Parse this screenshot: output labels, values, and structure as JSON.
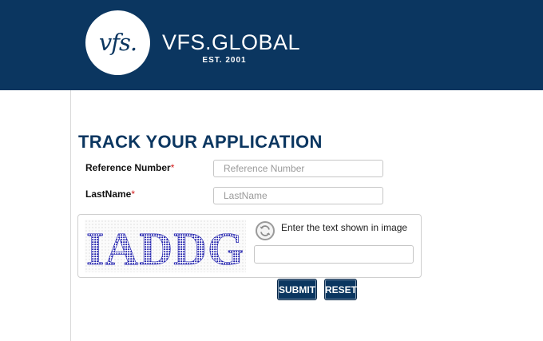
{
  "header": {
    "logo_mark": "vfs.",
    "brand": "VFS.GLOBAL",
    "established": "EST. 2001",
    "background": "#0b3660"
  },
  "form": {
    "title": "TRACK YOUR APPLICATION",
    "reference": {
      "label": "Reference Number",
      "required_mark": "*",
      "placeholder": "Reference Number",
      "value": ""
    },
    "lastname": {
      "label": "LastName",
      "required_mark": "*",
      "placeholder": "LastName",
      "value": ""
    },
    "captcha": {
      "image_text": "IADDG",
      "prompt": "Enter the text shown in image",
      "value": "",
      "refresh_icon": "refresh-icon"
    },
    "buttons": {
      "submit": "SUBMIT",
      "reset": "RESET"
    }
  },
  "colors": {
    "accent": "#0b3660",
    "required": "#d11a1a",
    "captcha_text": "#1a1aa8"
  }
}
